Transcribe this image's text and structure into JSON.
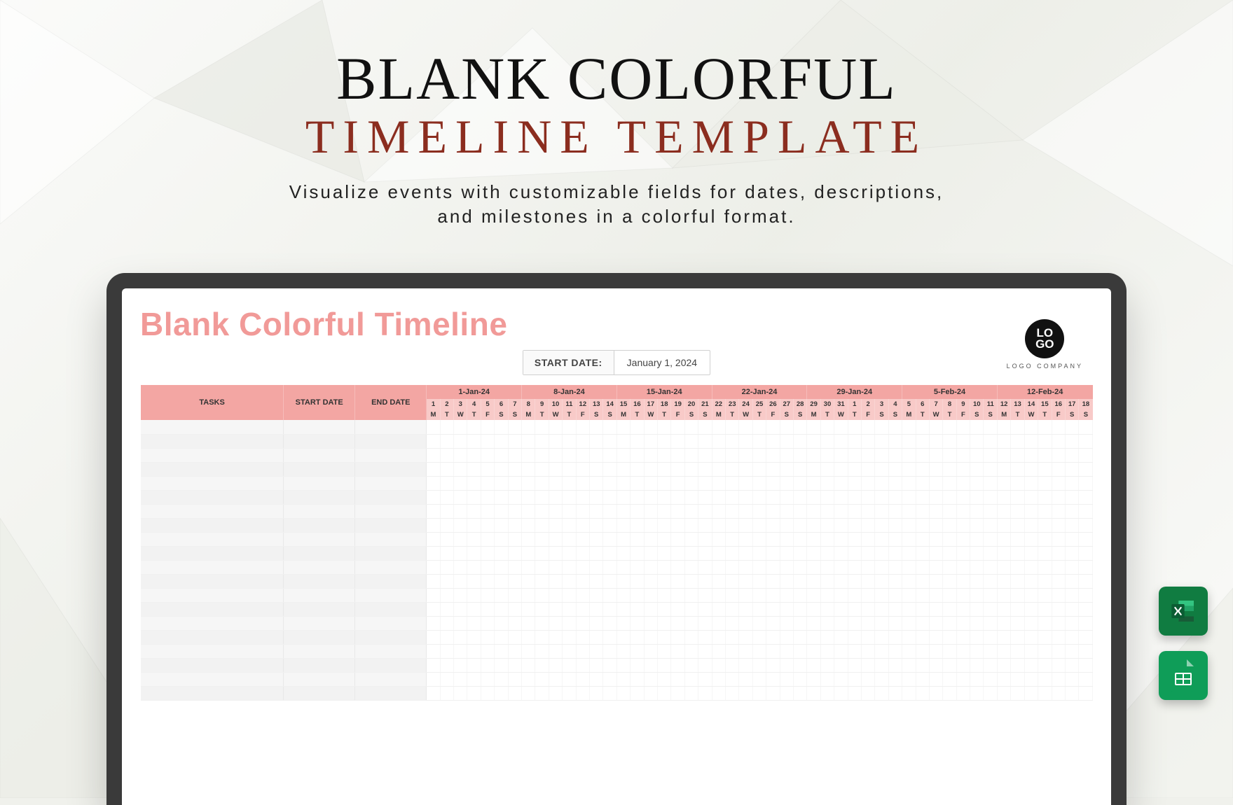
{
  "hero": {
    "title_main": "BLANK COLORFUL",
    "title_sub": "TIMELINE TEMPLATE",
    "subtitle_line1": "Visualize events with customizable fields for dates, descriptions,",
    "subtitle_line2": "and milestones in a colorful format."
  },
  "sheet": {
    "title": "Blank Colorful Timeline",
    "start_date_label": "START DATE:",
    "start_date_value": "January 1, 2024",
    "logo_text": "LO GO",
    "logo_company": "LOGO COMPANY",
    "columns": {
      "tasks": "TASKS",
      "start": "START DATE",
      "end": "END DATE"
    },
    "weeks": [
      "1-Jan-24",
      "8-Jan-24",
      "15-Jan-24",
      "22-Jan-24",
      "29-Jan-24",
      "5-Feb-24",
      "12-Feb-24"
    ],
    "day_nums": [
      "1",
      "2",
      "3",
      "4",
      "5",
      "6",
      "7",
      "8",
      "9",
      "10",
      "11",
      "12",
      "13",
      "14",
      "15",
      "16",
      "17",
      "18",
      "19",
      "20",
      "21",
      "22",
      "23",
      "24",
      "25",
      "26",
      "27",
      "28",
      "29",
      "30",
      "31",
      "1",
      "2",
      "3",
      "4",
      "5",
      "6",
      "7",
      "8",
      "9",
      "10",
      "11",
      "12",
      "13",
      "14",
      "15",
      "16",
      "17",
      "18"
    ],
    "day_wd": [
      "M",
      "T",
      "W",
      "T",
      "F",
      "S",
      "S",
      "M",
      "T",
      "W",
      "T",
      "F",
      "S",
      "S",
      "M",
      "T",
      "W",
      "T",
      "F",
      "S",
      "S",
      "M",
      "T",
      "W",
      "T",
      "F",
      "S",
      "S",
      "M",
      "T",
      "W",
      "T",
      "F",
      "S",
      "S",
      "M",
      "T",
      "W",
      "T",
      "F",
      "S",
      "S",
      "M",
      "T",
      "W",
      "T",
      "F",
      "S",
      "S"
    ],
    "blank_rows": 20
  },
  "formats": {
    "excel": "Excel",
    "sheets": "Google Sheets"
  }
}
